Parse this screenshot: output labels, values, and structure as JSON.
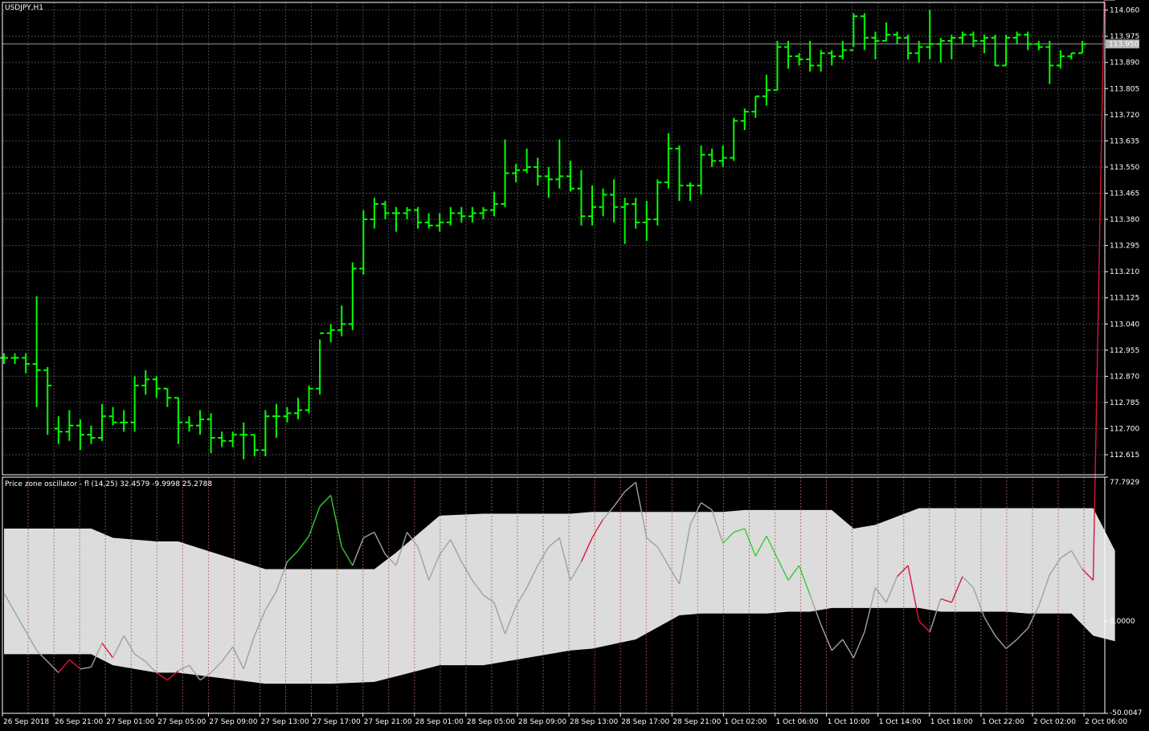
{
  "colors": {
    "background": "#000000",
    "grid": "#4a4a4a",
    "bars": "#00ff00",
    "axis_text": "#ffffff",
    "band_fill": "#dcdcdc",
    "osc_line": "#a0a0a0",
    "osc_up": "#32cd32",
    "osc_down": "#dc143c",
    "vline": "#b06060",
    "price_tag_bg": "#b4b4b4"
  },
  "chart_data": [
    {
      "type": "ohlc",
      "title": "USDJPY,H1",
      "current_price_label": "113.950",
      "current_price": 113.95,
      "ylim": [
        112.55,
        114.085
      ],
      "y_ticks": [
        "114.060",
        "113.975",
        "113.890",
        "113.805",
        "113.720",
        "113.635",
        "113.550",
        "113.465",
        "113.380",
        "113.295",
        "113.210",
        "113.125",
        "113.040",
        "112.955",
        "112.870",
        "112.785",
        "112.700",
        "112.615"
      ],
      "x_labels": [
        "26 Sep 2018",
        "26 Sep 21:00",
        "27 Sep 01:00",
        "27 Sep 05:00",
        "27 Sep 09:00",
        "27 Sep 13:00",
        "27 Sep 17:00",
        "27 Sep 21:00",
        "28 Sep 01:00",
        "28 Sep 05:00",
        "28 Sep 09:00",
        "28 Sep 13:00",
        "28 Sep 17:00",
        "28 Sep 21:00",
        "1 Oct 02:00",
        "1 Oct 06:00",
        "1 Oct 10:00",
        "1 Oct 14:00",
        "1 Oct 18:00",
        "1 Oct 22:00",
        "2 Oct 02:00",
        "2 Oct 06:00"
      ],
      "bars": [
        [
          112.93,
          112.945,
          112.91,
          112.93
        ],
        [
          112.93,
          112.945,
          112.91,
          112.93
        ],
        [
          112.93,
          112.945,
          112.88,
          112.91
        ],
        [
          112.91,
          113.13,
          112.77,
          112.89
        ],
        [
          112.89,
          112.9,
          112.68,
          112.84
        ],
        [
          112.7,
          112.74,
          112.65,
          112.69
        ],
        [
          112.69,
          112.76,
          112.66,
          112.71
        ],
        [
          112.71,
          112.73,
          112.63,
          112.68
        ],
        [
          112.68,
          112.71,
          112.65,
          112.67
        ],
        [
          112.67,
          112.78,
          112.66,
          112.74
        ],
        [
          112.74,
          112.77,
          112.71,
          112.72
        ],
        [
          112.72,
          112.76,
          112.69,
          112.72
        ],
        [
          112.72,
          112.87,
          112.69,
          112.84
        ],
        [
          112.84,
          112.89,
          112.81,
          112.86
        ],
        [
          112.86,
          112.87,
          112.8,
          112.83
        ],
        [
          112.83,
          112.83,
          112.77,
          112.8
        ],
        [
          112.8,
          112.8,
          112.65,
          112.72
        ],
        [
          112.72,
          112.74,
          112.69,
          112.71
        ],
        [
          112.71,
          112.76,
          112.68,
          112.73
        ],
        [
          112.73,
          112.75,
          112.62,
          112.67
        ],
        [
          112.67,
          112.69,
          112.64,
          112.66
        ],
        [
          112.66,
          112.69,
          112.64,
          112.68
        ],
        [
          112.68,
          112.72,
          112.6,
          112.68
        ],
        [
          112.68,
          112.68,
          112.61,
          112.63
        ],
        [
          112.63,
          112.76,
          112.61,
          112.74
        ],
        [
          112.74,
          112.78,
          112.67,
          112.74
        ],
        [
          112.74,
          112.77,
          112.72,
          112.75
        ],
        [
          112.75,
          112.8,
          112.73,
          112.76
        ],
        [
          112.76,
          112.84,
          112.75,
          112.83
        ],
        [
          112.83,
          112.99,
          112.81,
          113.01
        ],
        [
          113.01,
          113.04,
          112.98,
          113.02
        ],
        [
          113.02,
          113.1,
          113.0,
          113.04
        ],
        [
          113.04,
          113.24,
          113.02,
          113.22
        ],
        [
          113.22,
          113.41,
          113.2,
          113.38
        ],
        [
          113.38,
          113.45,
          113.35,
          113.43
        ],
        [
          113.43,
          113.44,
          113.38,
          113.4
        ],
        [
          113.4,
          113.42,
          113.34,
          113.4
        ],
        [
          113.4,
          113.42,
          113.38,
          113.41
        ],
        [
          113.41,
          113.42,
          113.35,
          113.37
        ],
        [
          113.37,
          113.4,
          113.35,
          113.36
        ],
        [
          113.36,
          113.4,
          113.34,
          113.37
        ],
        [
          113.37,
          113.42,
          113.36,
          113.4
        ],
        [
          113.4,
          113.42,
          113.37,
          113.39
        ],
        [
          113.39,
          113.42,
          113.37,
          113.4
        ],
        [
          113.4,
          113.42,
          113.38,
          113.41
        ],
        [
          113.41,
          113.47,
          113.39,
          113.43
        ],
        [
          113.43,
          113.64,
          113.42,
          113.53
        ],
        [
          113.53,
          113.56,
          113.5,
          113.54
        ],
        [
          113.54,
          113.61,
          113.53,
          113.55
        ],
        [
          113.55,
          113.58,
          113.49,
          113.52
        ],
        [
          113.52,
          113.55,
          113.45,
          113.51
        ],
        [
          113.51,
          113.64,
          113.48,
          113.52
        ],
        [
          113.52,
          113.57,
          113.47,
          113.48
        ],
        [
          113.48,
          113.54,
          113.36,
          113.39
        ],
        [
          113.39,
          113.49,
          113.36,
          113.42
        ],
        [
          113.42,
          113.48,
          113.39,
          113.46
        ],
        [
          113.46,
          113.51,
          113.37,
          113.42
        ],
        [
          113.42,
          113.45,
          113.3,
          113.43
        ],
        [
          113.43,
          113.45,
          113.35,
          113.37
        ],
        [
          113.37,
          113.44,
          113.31,
          113.38
        ],
        [
          113.38,
          113.51,
          113.36,
          113.5
        ],
        [
          113.5,
          113.66,
          113.48,
          113.61
        ],
        [
          113.61,
          113.62,
          113.44,
          113.49
        ],
        [
          113.49,
          113.5,
          113.44,
          113.49
        ],
        [
          113.49,
          113.62,
          113.46,
          113.59
        ],
        [
          113.59,
          113.61,
          113.55,
          113.57
        ],
        [
          113.57,
          113.62,
          113.55,
          113.58
        ],
        [
          113.58,
          113.71,
          113.57,
          113.7
        ],
        [
          113.7,
          113.74,
          113.67,
          113.73
        ],
        [
          113.73,
          113.78,
          113.71,
          113.78
        ],
        [
          113.78,
          113.85,
          113.75,
          113.8
        ],
        [
          113.8,
          113.96,
          113.8,
          113.94
        ],
        [
          113.94,
          113.96,
          113.87,
          113.91
        ],
        [
          113.91,
          113.92,
          113.88,
          113.9
        ],
        [
          113.9,
          113.96,
          113.86,
          113.88
        ],
        [
          113.88,
          113.93,
          113.86,
          113.92
        ],
        [
          113.92,
          113.93,
          113.88,
          113.91
        ],
        [
          113.91,
          113.96,
          113.9,
          113.93
        ],
        [
          113.93,
          114.05,
          113.94,
          114.04
        ],
        [
          114.04,
          114.05,
          113.93,
          113.97
        ],
        [
          113.97,
          113.99,
          113.9,
          113.96
        ],
        [
          113.96,
          114.02,
          113.96,
          113.98
        ],
        [
          113.98,
          113.99,
          113.95,
          113.97
        ],
        [
          113.97,
          113.98,
          113.9,
          113.92
        ],
        [
          113.92,
          113.96,
          113.89,
          113.94
        ],
        [
          113.94,
          114.06,
          113.9,
          113.95
        ],
        [
          113.95,
          113.97,
          113.89,
          113.96
        ],
        [
          113.96,
          113.98,
          113.9,
          113.97
        ],
        [
          113.97,
          113.99,
          113.95,
          113.98
        ],
        [
          113.98,
          113.99,
          113.94,
          113.96
        ],
        [
          113.96,
          113.98,
          113.92,
          113.97
        ],
        [
          113.97,
          113.98,
          113.88,
          113.88
        ],
        [
          113.88,
          113.98,
          113.88,
          113.97
        ],
        [
          113.97,
          113.99,
          113.95,
          113.98
        ],
        [
          113.98,
          113.99,
          113.93,
          113.95
        ],
        [
          113.95,
          113.96,
          113.93,
          113.94
        ],
        [
          113.94,
          113.96,
          113.82,
          113.88
        ],
        [
          113.88,
          113.93,
          113.87,
          113.91
        ],
        [
          113.91,
          113.92,
          113.9,
          113.92
        ],
        [
          113.92,
          113.96,
          113.92,
          113.95
        ]
      ]
    },
    {
      "type": "line",
      "title": "Price zone oscillator - fl (14,25) 32.4579 -9.9998 25.2788",
      "ylim": [
        -50.0047,
        77.7929
      ],
      "y_ticks": [
        "77.7929",
        "0.0000",
        "-50.0047"
      ],
      "zero_level": 0,
      "band": {
        "x": [
          0,
          8,
          10,
          14,
          16,
          24,
          26,
          28,
          30,
          34,
          36,
          40,
          44,
          46,
          48,
          50,
          52,
          54,
          58,
          62,
          64,
          66,
          68,
          70,
          72,
          74,
          76,
          78,
          80,
          84,
          86,
          88,
          92,
          94,
          96,
          98,
          100,
          102
        ],
        "upper": [
          50,
          50,
          45,
          43,
          43,
          28,
          28,
          28,
          28,
          28,
          37,
          57,
          58,
          58,
          58,
          58,
          58,
          59,
          59,
          59,
          59,
          59,
          60,
          60,
          60,
          60,
          60,
          50,
          52,
          61,
          61,
          61,
          61,
          61,
          61,
          61,
          61,
          38
        ],
        "lower": [
          -18,
          -18,
          -24,
          -28,
          -28,
          -34,
          -34,
          -34,
          -34,
          -33,
          -30,
          -24,
          -24,
          -22,
          -20,
          -18,
          -16,
          -15,
          -10,
          3,
          4,
          4,
          4,
          4,
          5,
          5,
          7,
          7,
          7,
          7,
          5,
          5,
          5,
          4,
          4,
          4,
          -8,
          -11
        ]
      },
      "osc": {
        "x": [
          0,
          3,
          5,
          6,
          7,
          8,
          9,
          10,
          11,
          12,
          13,
          14,
          15,
          16,
          17,
          18,
          19,
          20,
          21,
          22,
          23,
          24,
          25,
          26,
          27,
          28,
          29,
          30,
          31,
          32,
          33,
          34,
          35,
          36,
          37,
          38,
          39,
          40,
          41,
          42,
          43,
          44,
          45,
          46,
          47,
          48,
          49,
          50,
          51,
          52,
          53,
          54,
          55,
          56,
          57,
          58,
          59,
          60,
          61,
          62,
          63,
          64,
          65,
          66,
          67,
          68,
          69,
          70,
          71,
          72,
          73,
          74,
          75,
          76,
          77,
          78,
          79,
          80,
          81,
          82,
          83,
          84,
          85,
          86,
          87,
          88,
          89,
          90,
          91,
          92,
          93,
          94,
          95,
          96,
          97,
          98,
          99,
          100,
          101,
          102
        ],
        "y": [
          15,
          -16,
          -28,
          -21,
          -26,
          -25,
          -12,
          -20,
          -8,
          -18,
          -22,
          -28,
          -32,
          -27,
          -24,
          -32,
          -28,
          -22,
          -14,
          -26,
          -8,
          6,
          16,
          32,
          38,
          46,
          62,
          68,
          40,
          30,
          45,
          48,
          36,
          30,
          48,
          40,
          22,
          36,
          44,
          32,
          22,
          14,
          10,
          -7,
          8,
          18,
          30,
          40,
          45,
          22,
          32,
          45,
          55,
          62,
          70,
          75,
          45,
          40,
          30,
          20,
          52,
          64,
          60,
          42,
          48,
          50,
          35,
          46,
          34,
          22,
          30,
          14,
          -2,
          -16,
          -10,
          -20,
          -6,
          18,
          10,
          24,
          30,
          0,
          -6,
          12,
          10,
          24,
          18,
          2,
          -8,
          -15,
          -10,
          -4,
          8,
          25,
          34,
          38,
          28,
          22
        ],
        "up_segments": [
          [
            23,
            29
          ],
          [
            63,
            71
          ]
        ],
        "down_segments": [
          [
            2,
            4
          ],
          [
            6,
            7
          ],
          [
            11,
            13
          ],
          [
            50,
            52
          ],
          [
            79,
            82
          ],
          [
            83,
            85
          ],
          [
            96,
            98
          ]
        ]
      }
    }
  ]
}
